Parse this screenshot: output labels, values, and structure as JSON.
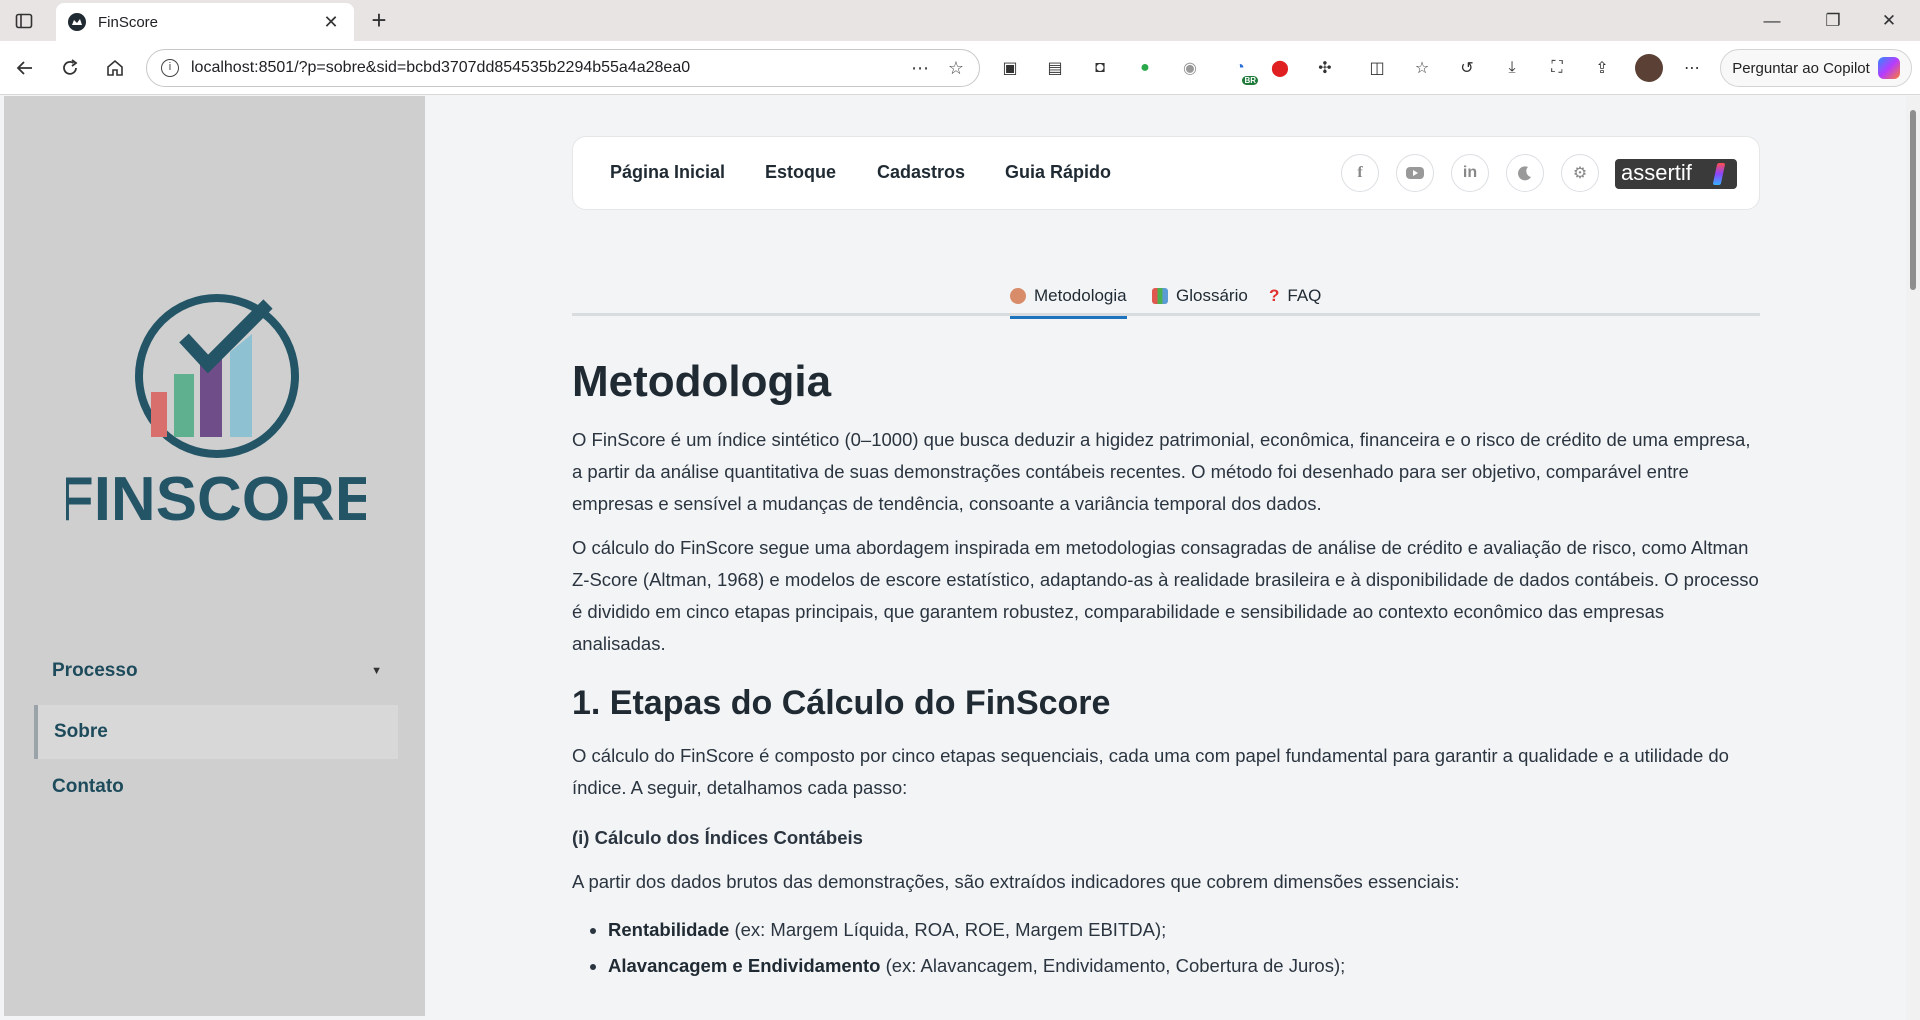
{
  "browser": {
    "tab_title": "FinScore",
    "url": "localhost:8501/?p=sobre&sid=bcbd3707dd854535b2294b55a4a28ea0",
    "copilot_label": "Perguntar ao Copilot",
    "extension_badge": "BR"
  },
  "sidebar": {
    "logo_text": "FINSCORE",
    "items": [
      {
        "label": "Processo",
        "expandable": true
      },
      {
        "label": "Sobre",
        "active": true
      },
      {
        "label": "Contato"
      }
    ]
  },
  "topnav": {
    "links": [
      "Página Inicial",
      "Estoque",
      "Cadastros",
      "Guia Rápido"
    ],
    "social_icons": [
      "facebook-icon",
      "youtube-icon",
      "linkedin-icon",
      "moon-icon",
      "gear-icon"
    ],
    "brand": "assertif"
  },
  "tabs": [
    {
      "label": "Metodologia",
      "active": true,
      "icon_color": "#d98c6a"
    },
    {
      "label": "Glossário",
      "icon_color": "#5b9bd5"
    },
    {
      "label": "FAQ",
      "icon_color": "#e03030"
    }
  ],
  "content": {
    "title": "Metodologia",
    "para1": "O FinScore é um índice sintético (0–1000) que busca deduzir a higidez patrimonial, econômica, financeira e o risco de crédito de uma empresa, a partir da análise quantitativa de suas demonstrações contábeis recentes. O método foi desenhado para ser objetivo, comparável entre empresas e sensível a mudanças de tendência, consoante a variância temporal dos dados.",
    "para2": "O cálculo do FinScore segue uma abordagem inspirada em metodologias consagradas de análise de crédito e avaliação de risco, como Altman Z-Score (Altman, 1968) e modelos de escore estatístico, adaptando-as à realidade brasileira e à disponibilidade de dados contábeis. O processo é dividido em cinco etapas principais, que garantem robustez, comparabilidade e sensibilidade ao contexto econômico das empresas analisadas.",
    "section1_title": "1. Etapas do Cálculo do FinScore",
    "para3": "O cálculo do FinScore é composto por cinco etapas sequenciais, cada uma com papel fundamental para garantir a qualidade e a utilidade do índice. A seguir, detalhamos cada passo:",
    "subtitle1": "(i) Cálculo dos Índices Contábeis",
    "para4": "A partir dos dados brutos das demonstrações, são extraídos indicadores que cobrem dimensões essenciais:",
    "bullets": [
      {
        "term": "Rentabilidade",
        "detail": " (ex: Margem Líquida, ROA, ROE, Margem EBITDA);"
      },
      {
        "term": "Alavancagem e Endividamento",
        "detail": " (ex: Alavancagem, Endividamento, Cobertura de Juros);"
      }
    ]
  }
}
